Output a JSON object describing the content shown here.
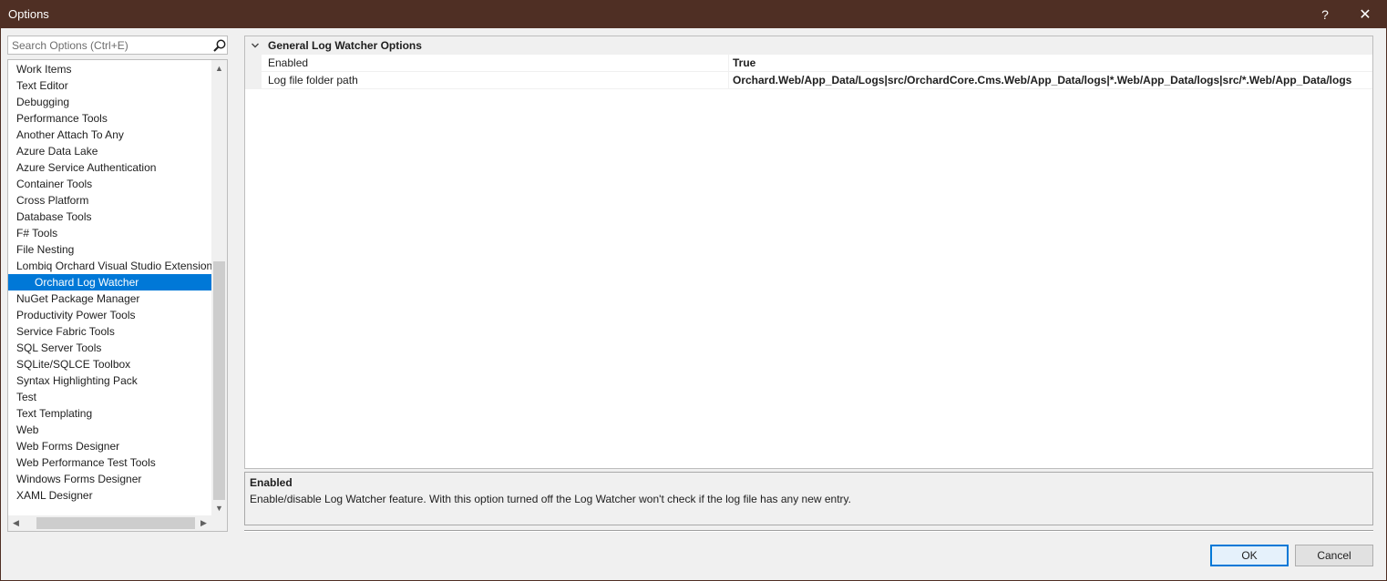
{
  "window": {
    "title": "Options",
    "help_glyph": "?",
    "close_glyph": "✕"
  },
  "search": {
    "placeholder": "Search Options (Ctrl+E)",
    "value": ""
  },
  "tree": {
    "items": [
      {
        "label": "Work Items"
      },
      {
        "label": "Text Editor"
      },
      {
        "label": "Debugging"
      },
      {
        "label": "Performance Tools"
      },
      {
        "label": "Another Attach To Any"
      },
      {
        "label": "Azure Data Lake"
      },
      {
        "label": "Azure Service Authentication"
      },
      {
        "label": "Container Tools"
      },
      {
        "label": "Cross Platform"
      },
      {
        "label": "Database Tools"
      },
      {
        "label": "F# Tools"
      },
      {
        "label": "File Nesting"
      },
      {
        "label": "Lombiq Orchard Visual Studio Extension"
      },
      {
        "label": "Orchard Log Watcher",
        "child": true,
        "selected": true
      },
      {
        "label": "NuGet Package Manager"
      },
      {
        "label": "Productivity Power Tools"
      },
      {
        "label": "Service Fabric Tools"
      },
      {
        "label": "SQL Server Tools"
      },
      {
        "label": "SQLite/SQLCE Toolbox"
      },
      {
        "label": "Syntax Highlighting Pack"
      },
      {
        "label": "Test"
      },
      {
        "label": "Text Templating"
      },
      {
        "label": "Web"
      },
      {
        "label": "Web Forms Designer"
      },
      {
        "label": "Web Performance Test Tools"
      },
      {
        "label": "Windows Forms Designer"
      },
      {
        "label": "XAML Designer"
      }
    ]
  },
  "property_grid": {
    "category": "General Log Watcher Options",
    "rows": [
      {
        "name": "Enabled",
        "value": "True"
      },
      {
        "name": "Log file folder path",
        "value": "Orchard.Web/App_Data/Logs|src/OrchardCore.Cms.Web/App_Data/logs|*.Web/App_Data/logs|src/*.Web/App_Data/logs"
      }
    ]
  },
  "description": {
    "title": "Enabled",
    "text": "Enable/disable Log Watcher feature. With this option turned off the Log Watcher won't check if the log file has any new entry."
  },
  "buttons": {
    "ok": "OK",
    "cancel": "Cancel"
  },
  "colors": {
    "titlebar": "#4f2f24",
    "selection": "#0078d7"
  }
}
